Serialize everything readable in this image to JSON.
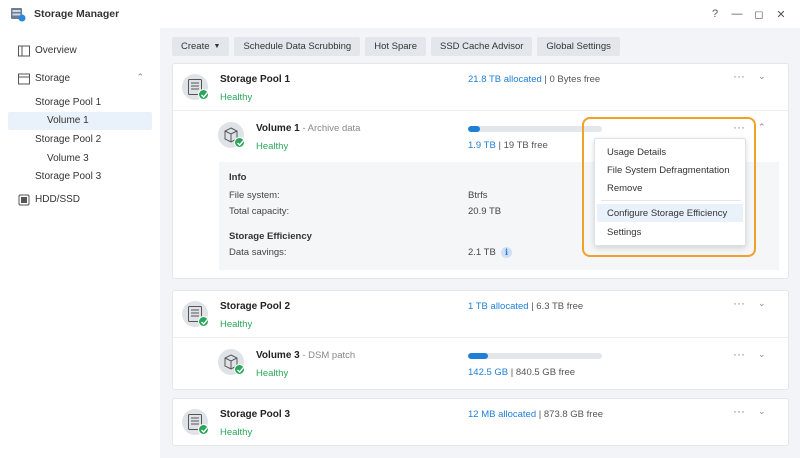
{
  "window": {
    "title": "Storage Manager",
    "help_glyph": "?",
    "min_glyph": "—",
    "max_glyph": "◻",
    "close_glyph": "✕"
  },
  "sidebar": {
    "items": [
      {
        "label": "Overview",
        "icon": "overview-icon"
      },
      {
        "label": "Storage",
        "icon": "storage-icon",
        "chevron": "⌃"
      },
      {
        "label": "Storage Pool 1"
      },
      {
        "label": "Volume 1",
        "active": true
      },
      {
        "label": "Storage Pool 2"
      },
      {
        "label": "Volume 3"
      },
      {
        "label": "Storage Pool 3"
      },
      {
        "label": "HDD/SSD",
        "icon": "hdd-icon"
      }
    ]
  },
  "toolbar": {
    "create": "Create",
    "scrub": "Schedule Data Scrubbing",
    "hotspare": "Hot Spare",
    "ssd": "SSD Cache Advisor",
    "global": "Global Settings"
  },
  "pools": [
    {
      "name": "Storage Pool 1",
      "status": "Healthy",
      "allocated": "21.8 TB allocated",
      "free": " | 0 Bytes free",
      "volume": {
        "name": "Volume 1",
        "desc": " - Archive data",
        "status": "Healthy",
        "used": "1.9 TB",
        "total": " | 19 TB free",
        "usage_fraction": 0.09
      }
    },
    {
      "name": "Storage Pool 2",
      "status": "Healthy",
      "allocated": "1 TB allocated",
      "free": " | 6.3 TB free",
      "volume": {
        "name": "Volume 3",
        "desc": " - DSM patch",
        "status": "Healthy",
        "used": "142.5 GB",
        "total": " | 840.5 GB free",
        "usage_fraction": 0.15
      }
    },
    {
      "name": "Storage Pool 3",
      "status": "Healthy",
      "allocated": "12 MB allocated",
      "free": " | 873.8 GB free"
    }
  ],
  "info": {
    "heading": "Info",
    "fs_label": "File system:",
    "fs_value": "Btrfs",
    "cap_label": "Total capacity:",
    "cap_value": "20.9 TB",
    "eff_heading": "Storage Efficiency",
    "savings_label": "Data savings:",
    "savings_value": "2.1 TB",
    "info_glyph": "i"
  },
  "menu": {
    "items": [
      "Usage Details",
      "File System Defragmentation",
      "Remove",
      "Configure Storage Efficiency",
      "Settings"
    ],
    "highlight_color": "#f0a12a"
  },
  "glyphs": {
    "dots": "···",
    "chev_down": "⌄",
    "chev_up": "⌃"
  },
  "colors": {
    "accent": "#1f7fd6",
    "healthy": "#2aa65a"
  }
}
